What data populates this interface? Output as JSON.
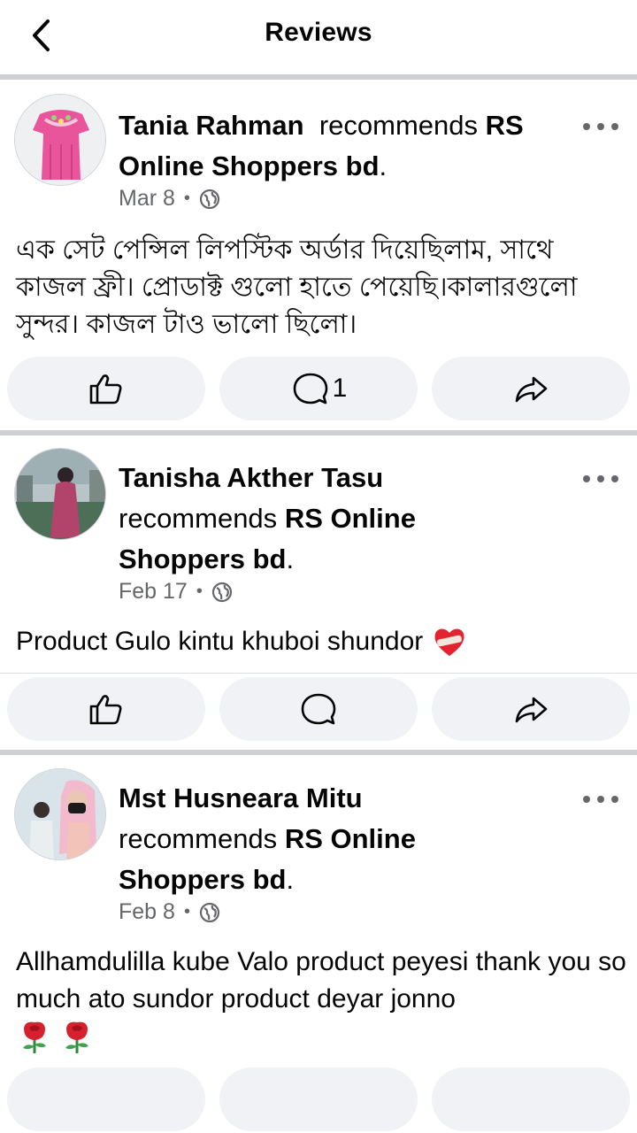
{
  "header": {
    "title": "Reviews",
    "back_icon": "chevron-left-icon"
  },
  "reviews": [
    {
      "name": "Tania Rahman",
      "verb": "recommends",
      "page": "RS Online Shoppers bd",
      "end": ".",
      "date": "Mar 8",
      "separator": "•",
      "privacy_icon": "globe-icon",
      "text": "এক সেট পেন্সিল লিপস্টিক অর্ডার দিয়েছিলাম,  সাথে কাজল ফ্রী।  প্রোডাক্ট গুলো হাতে পেয়েছি।কালারগুলো সুন্দর। কাজল টাও ভালো ছিলো।",
      "comment_count": "1"
    },
    {
      "name": "Tanisha Akther Tasu",
      "verb": "recommends",
      "page": "RS Online Shoppers bd",
      "end": ".",
      "date": "Feb 17",
      "separator": "•",
      "privacy_icon": "globe-icon",
      "text": "Product Gulo kintu khuboi shundor",
      "text_emoji": "heart-with-bandage-icon"
    },
    {
      "name": "Mst Husneara Mitu",
      "verb": "recommends",
      "page": "RS Online Shoppers bd",
      "end": ".",
      "date": "Feb 8",
      "separator": "•",
      "privacy_icon": "globe-icon",
      "text": "Allhamdulilla kube Valo product peyesi thank you so much ato sundor product deyar jonno",
      "text_emoji": "rose-icon"
    }
  ],
  "action_icons": {
    "like": "thumbs-up-icon",
    "comment": "comment-icon",
    "share": "share-icon",
    "more": "more-horizontal-icon"
  },
  "colors": {
    "separator": "#ced0d4",
    "button_bg": "#f0f2f5",
    "meta_text": "#65676b",
    "text": "#050505"
  }
}
